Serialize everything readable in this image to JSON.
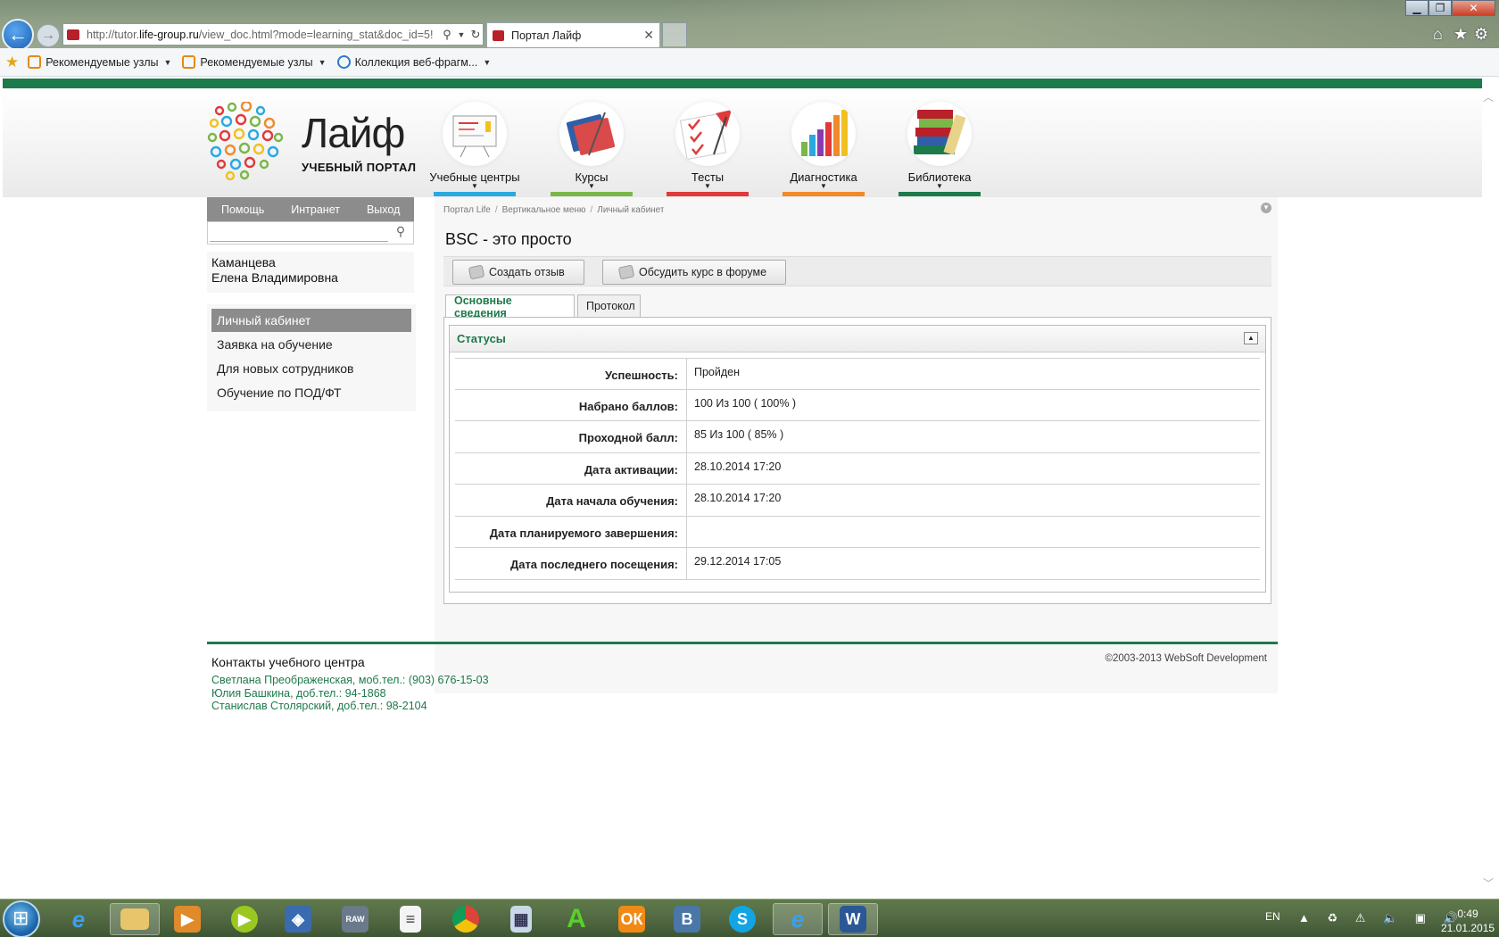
{
  "browser": {
    "url_prefix": "http://tutor.",
    "url_domain": "life-group.ru",
    "url_rest": "/view_doc.html?mode=learning_stat&doc_id=5!",
    "tab_title": "Портал Лайф",
    "favorites": [
      "Рекомендуемые узлы",
      "Рекомендуемые узлы",
      "Коллекция веб-фрагм..."
    ]
  },
  "logo": {
    "title": "Лайф",
    "subtitle": "УЧЕБНЫЙ ПОРТАЛ"
  },
  "topnav": [
    {
      "label": "Учебные центры",
      "color": "#2aa8e0"
    },
    {
      "label": "Курсы",
      "color": "#7ab648"
    },
    {
      "label": "Тесты",
      "color": "#e03a3a"
    },
    {
      "label": "Диагностика",
      "color": "#f08a2a"
    },
    {
      "label": "Библиотека",
      "color": "#1d7a4a"
    }
  ],
  "left_menu": {
    "help": "Помощь",
    "intranet": "Интранет",
    "logout": "Выход"
  },
  "search": {
    "placeholder": ""
  },
  "user": {
    "last_name": "Каманцева",
    "first_names": "Елена Владимировна"
  },
  "side_menu": [
    "Личный кабинет",
    "Заявка на обучение",
    "Для новых сотрудников",
    "Обучение по ПОД/ФТ"
  ],
  "breadcrumb": [
    "Портал Life",
    "Вертикальное меню",
    "Личный кабинет"
  ],
  "page_title": "BSC - это просто",
  "actions": {
    "review": "Создать отзыв",
    "forum": "Обсудить курс в форуме"
  },
  "tabs": {
    "main": "Основные сведения",
    "protocol": "Протокол"
  },
  "status_section": {
    "title": "Статусы",
    "rows": [
      {
        "label": "Успешность:",
        "value": "Пройден"
      },
      {
        "label": "Набрано баллов:",
        "value": "100 Из 100 ( 100% )"
      },
      {
        "label": "Проходной балл:",
        "value": "85 Из 100 ( 85% )"
      },
      {
        "label": "Дата активации:",
        "value": "28.10.2014 17:20"
      },
      {
        "label": "Дата начала обучения:",
        "value": "28.10.2014 17:20"
      },
      {
        "label": "Дата планируемого завершения:",
        "value": ""
      },
      {
        "label": "Дата последнего посещения:",
        "value": "29.12.2014 17:05"
      }
    ]
  },
  "footer": {
    "title": "Контакты учебного центра",
    "contacts": [
      "Светлана Преображенская, моб.тел.: (903) 676-15-03",
      "Юлия Башкина, доб.тел.: 94-1868",
      "Станислав Столярский, доб.тел.: 98-2104"
    ],
    "copyright": "©2003-2013 WebSoft Development"
  },
  "taskbar": {
    "lang": "EN",
    "time": "0:49",
    "date": "21.01.2015",
    "apps": [
      "ie-icon",
      "explorer-icon",
      "media-player-icon",
      "player-icon",
      "xara-icon",
      "raw-icon",
      "notepad-icon",
      "chrome-icon",
      "calculator-icon",
      "acrobat-icon",
      "odnoklassniki-icon",
      "vk-icon",
      "skype-icon",
      "ie-active-icon",
      "word-icon"
    ],
    "app_glyphs": {
      "raw": "RAW",
      "vk": "В",
      "word": "W",
      "skype": "S",
      "acrobat": "A"
    }
  },
  "colors": {
    "brand_green": "#1d7a4a",
    "menu_gray": "#8c8c8c"
  }
}
